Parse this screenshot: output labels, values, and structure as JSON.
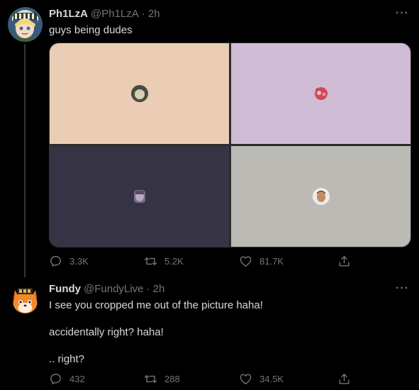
{
  "tweets": [
    {
      "name": "Ph1LzA",
      "handle": "@Ph1LzA",
      "time": "· 2h",
      "more": "···",
      "lines": [
        "guys being dudes"
      ],
      "stats": {
        "replies": "3.3K",
        "retweets": "5.2K",
        "likes": "81.7K"
      },
      "tiles_colors": [
        "#eacdb4",
        "#d0bcd4",
        "#363444",
        "#bbbab4"
      ]
    },
    {
      "name": "Fundy",
      "handle": "@FundyLive",
      "time": "· 2h",
      "more": "···",
      "lines": [
        "I see you cropped me out of the picture haha!",
        "accidentally right? haha!",
        ".. right?"
      ],
      "stats": {
        "replies": "432",
        "retweets": "288",
        "likes": "34.5K"
      }
    }
  ],
  "icons": [
    "reply-icon",
    "retweet-icon",
    "like-icon",
    "share-icon",
    "more-icon"
  ]
}
